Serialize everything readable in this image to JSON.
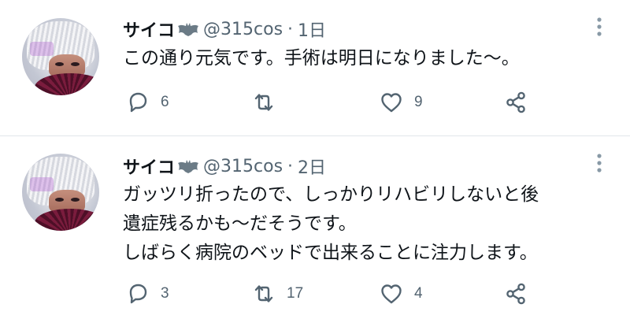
{
  "tweets": [
    {
      "name": "サイコ",
      "handle": "@315cos",
      "separator": "·",
      "time": "1日",
      "text_lines": [
        "この通り元気です。手術は明日になりました〜。"
      ],
      "replies": "6",
      "retweets": "",
      "likes": "9"
    },
    {
      "name": "サイコ",
      "handle": "@315cos",
      "separator": "·",
      "time": "2日",
      "text_lines": [
        "ガッツリ折ったので、しっかりリハビリしないと後",
        "遺症残るかも〜だそうです。",
        "しばらく病院のベッドで出来ることに注力します。"
      ],
      "replies": "3",
      "retweets": "17",
      "likes": "4"
    }
  ],
  "icons": {
    "name_badge": "bat-icon",
    "reply": "reply-icon",
    "retweet": "retweet-icon",
    "like": "heart-icon",
    "share": "share-icon",
    "more": "more-icon"
  },
  "colors": {
    "text": "#0f1419",
    "secondary": "#536471",
    "divider": "#e1e6ea",
    "icon": "#536471"
  }
}
